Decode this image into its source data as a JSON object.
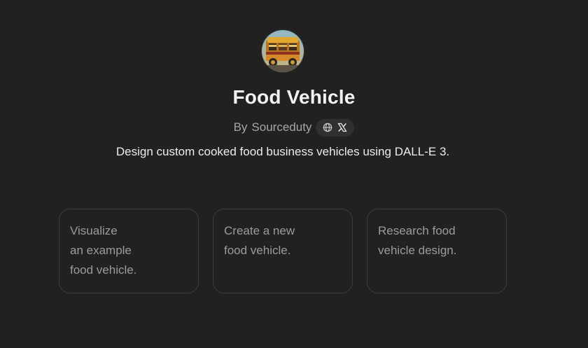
{
  "gpt": {
    "name": "Food Vehicle",
    "by_prefix": "By",
    "author": "Sourceduty",
    "description": "Design custom cooked food business vehicles using DALL-E 3.",
    "icons": [
      "globe-icon",
      "x-logo-icon"
    ]
  },
  "starters": [
    {
      "text": "Visualize\nan example\nfood vehicle."
    },
    {
      "text": "Create a new\nfood vehicle."
    },
    {
      "text": "Research food\nvehicle design."
    }
  ],
  "colors": {
    "background": "#212121",
    "text_primary": "#ececec",
    "text_secondary": "#a6a6a6",
    "card_border": "#3c3c3c"
  }
}
